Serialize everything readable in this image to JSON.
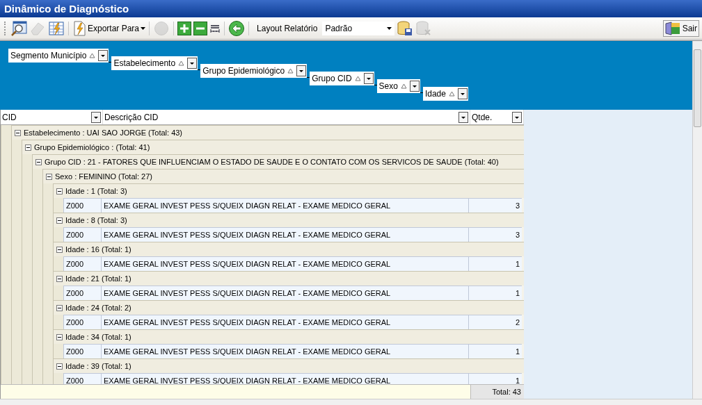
{
  "window": {
    "title": "Dinâmico de Diagnóstico"
  },
  "toolbar": {
    "buttons": [
      {
        "disabled": false
      },
      {
        "disabled": true
      },
      {
        "disabled": false
      }
    ],
    "export_label": "Exportar Para",
    "buttons_2": [
      {
        "disabled": true
      },
      {
        "disabled": false
      },
      {
        "disabled": false
      },
      {
        "disabled": false
      },
      {
        "disabled": false
      }
    ],
    "layout_label": "Layout Relatório",
    "layout_value": "Padrão",
    "buttons_3": [
      {
        "disabled": false
      },
      {
        "disabled": true
      }
    ],
    "exit_label": "Sair"
  },
  "group_by": [
    {
      "label": "Segmento Município"
    },
    {
      "label": "Estabelecimento"
    },
    {
      "label": "Grupo Epidemiológico"
    },
    {
      "label": "Grupo CID"
    },
    {
      "label": "Sexo"
    },
    {
      "label": "Idade"
    }
  ],
  "columns": [
    {
      "label": "CID"
    },
    {
      "label": "Descrição CID"
    },
    {
      "label": "Qtde."
    }
  ],
  "tree": [
    {
      "kind": "group",
      "label": "Estabelecimento : UAI SAO JORGE (Total: 43)",
      "expanded": true,
      "children": [
        {
          "kind": "group",
          "label": "Grupo Epidemiológico :  (Total: 41)",
          "expanded": true,
          "children": [
            {
              "kind": "group",
              "label": "Grupo CID : 21 - FATORES QUE INFLUENCIAM O ESTADO DE SAUDE E O CONTATO COM OS SERVICOS DE SAUDE (Total: 40)",
              "expanded": true,
              "children": [
                {
                  "kind": "group",
                  "label": "Sexo : FEMININO (Total: 27)",
                  "expanded": true,
                  "children": [
                    {
                      "kind": "group",
                      "label": "Idade : 1 (Total: 3)",
                      "expanded": true,
                      "children": [
                        {
                          "kind": "row",
                          "cid": "Z000",
                          "descricao": "EXAME GERAL INVEST PESS S/QUEIX DIAGN RELAT - EXAME MEDICO GERAL",
                          "qtde": "3"
                        }
                      ]
                    },
                    {
                      "kind": "group",
                      "label": "Idade : 8 (Total: 3)",
                      "expanded": true,
                      "children": [
                        {
                          "kind": "row",
                          "cid": "Z000",
                          "descricao": "EXAME GERAL INVEST PESS S/QUEIX DIAGN RELAT - EXAME MEDICO GERAL",
                          "qtde": "3"
                        }
                      ]
                    },
                    {
                      "kind": "group",
                      "label": "Idade : 16 (Total: 1)",
                      "expanded": true,
                      "children": [
                        {
                          "kind": "row",
                          "cid": "Z000",
                          "descricao": "EXAME GERAL INVEST PESS S/QUEIX DIAGN RELAT - EXAME MEDICO GERAL",
                          "qtde": "1"
                        }
                      ]
                    },
                    {
                      "kind": "group",
                      "label": "Idade : 21 (Total: 1)",
                      "expanded": true,
                      "children": [
                        {
                          "kind": "row",
                          "cid": "Z000",
                          "descricao": "EXAME GERAL INVEST PESS S/QUEIX DIAGN RELAT - EXAME MEDICO GERAL",
                          "qtde": "1"
                        }
                      ]
                    },
                    {
                      "kind": "group",
                      "label": "Idade : 24 (Total: 2)",
                      "expanded": true,
                      "children": [
                        {
                          "kind": "row",
                          "cid": "Z000",
                          "descricao": "EXAME GERAL INVEST PESS S/QUEIX DIAGN RELAT - EXAME MEDICO GERAL",
                          "qtde": "2"
                        }
                      ]
                    },
                    {
                      "kind": "group",
                      "label": "Idade : 34 (Total: 1)",
                      "expanded": true,
                      "children": [
                        {
                          "kind": "row",
                          "cid": "Z000",
                          "descricao": "EXAME GERAL INVEST PESS S/QUEIX DIAGN RELAT - EXAME MEDICO GERAL",
                          "qtde": "1"
                        }
                      ]
                    },
                    {
                      "kind": "group",
                      "label": "Idade : 39 (Total: 1)",
                      "expanded": true,
                      "children": [
                        {
                          "kind": "row",
                          "cid": "Z000",
                          "descricao": "EXAME GERAL INVEST PESS S/QUEIX DIAGN RELAT - EXAME MEDICO GERAL",
                          "qtde": "1"
                        }
                      ]
                    }
                  ]
                }
              ]
            }
          ]
        }
      ]
    }
  ],
  "footer": {
    "total": "Total: 43"
  }
}
